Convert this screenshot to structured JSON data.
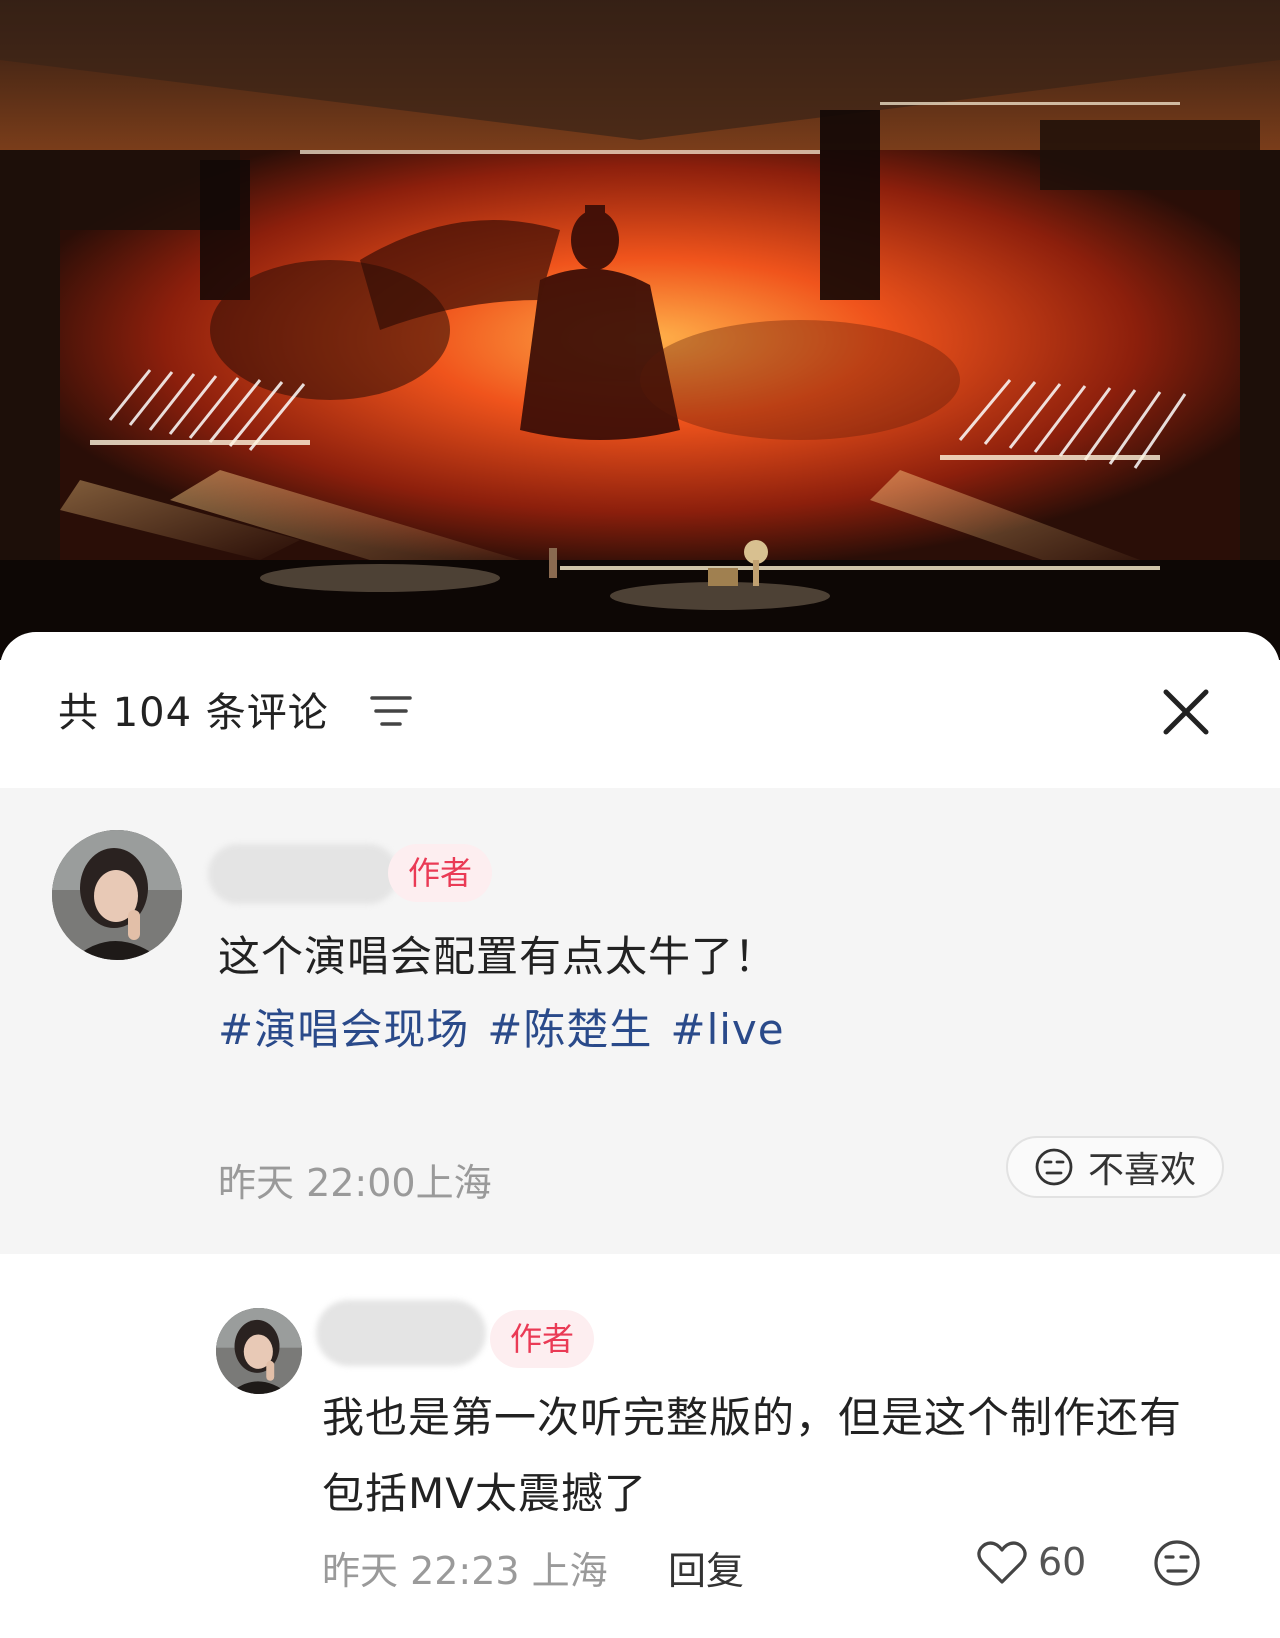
{
  "header": {
    "comment_count_label": "共 104 条评论"
  },
  "main_comment": {
    "badge": "作者",
    "text": "这个演唱会配置有点太牛了！",
    "tags": [
      "#演唱会现场",
      "#陈楚生",
      "#live"
    ],
    "meta": "昨天 22:00上海",
    "dislike_label": "不喜欢"
  },
  "reply": {
    "badge": "作者",
    "text": "我也是第一次听完整版的，但是这个制作还有包括MV太震撼了",
    "meta": "昨天 22:23 上海",
    "reply_label": "回复",
    "like_count": "60"
  },
  "colors": {
    "badge_text": "#ea3a55",
    "badge_bg": "#fdeef0",
    "tag_text": "#2a4a8a",
    "highlight_bg": "#f5f5f5"
  }
}
